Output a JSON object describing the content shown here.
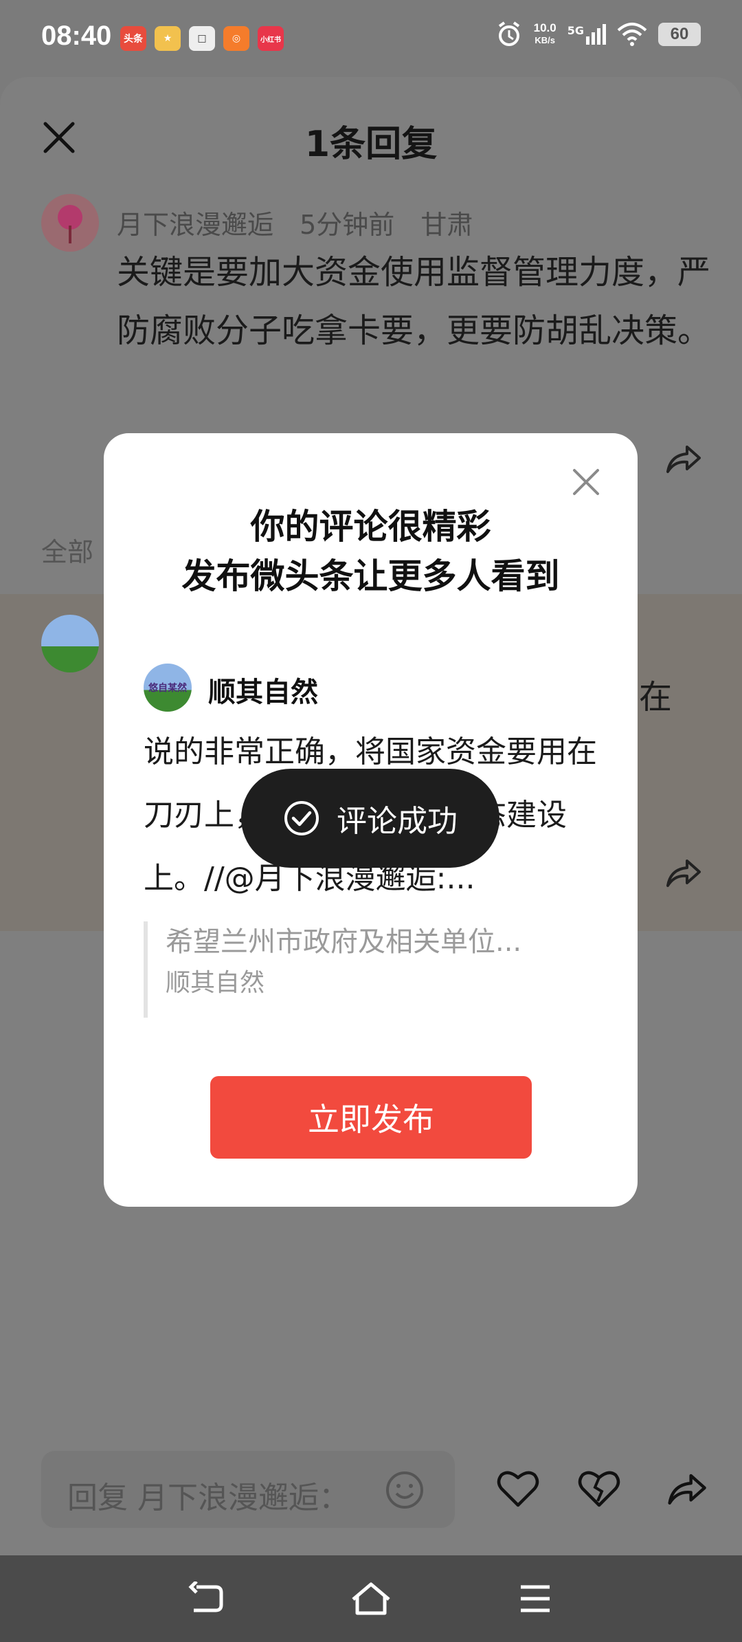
{
  "status_bar": {
    "time": "08:40",
    "apps": [
      {
        "name": "toutiao-app-icon",
        "label": "头条",
        "color": "#e84c3d"
      },
      {
        "name": "app-icon-2",
        "label": "★",
        "color": "#f2c14e"
      },
      {
        "name": "app-icon-3",
        "label": "□",
        "color": "#eeeeee"
      },
      {
        "name": "app-icon-4",
        "label": "◎",
        "color": "#f57c2b"
      },
      {
        "name": "xiaohongshu-app-icon",
        "label": "小红书",
        "color": "#e8364a"
      }
    ],
    "network_speed": "10.0",
    "network_unit": "KB/s",
    "network_type": "5G",
    "battery": "60"
  },
  "sheet": {
    "title": "1条回复"
  },
  "comment": {
    "author": "月下浪漫邂逅",
    "time": "5分钟前",
    "location": "甘肃",
    "text": "关键是要加大资金使用监督管理力度，严防腐败分子吃拿卡要，更要防胡乱决策。"
  },
  "section_label": "全部",
  "reply_peek_char": "在",
  "popup": {
    "title_line1": "你的评论很精彩",
    "title_line2": "发布微头条让更多人看到",
    "avatar_text": "悠自某然",
    "user_name": "顺其自然",
    "post_text": "说的非常正确，将国家资金要用在刀刃上，用在刀刃兰州生态建设上。//@月下浪漫邂逅:...",
    "quote_text": "希望兰州市政府及相关单位...",
    "quote_author": "顺其自然",
    "publish_label": "立即发布"
  },
  "toast": {
    "text": "评论成功"
  },
  "input": {
    "placeholder": "回复 月下浪漫邂逅："
  }
}
